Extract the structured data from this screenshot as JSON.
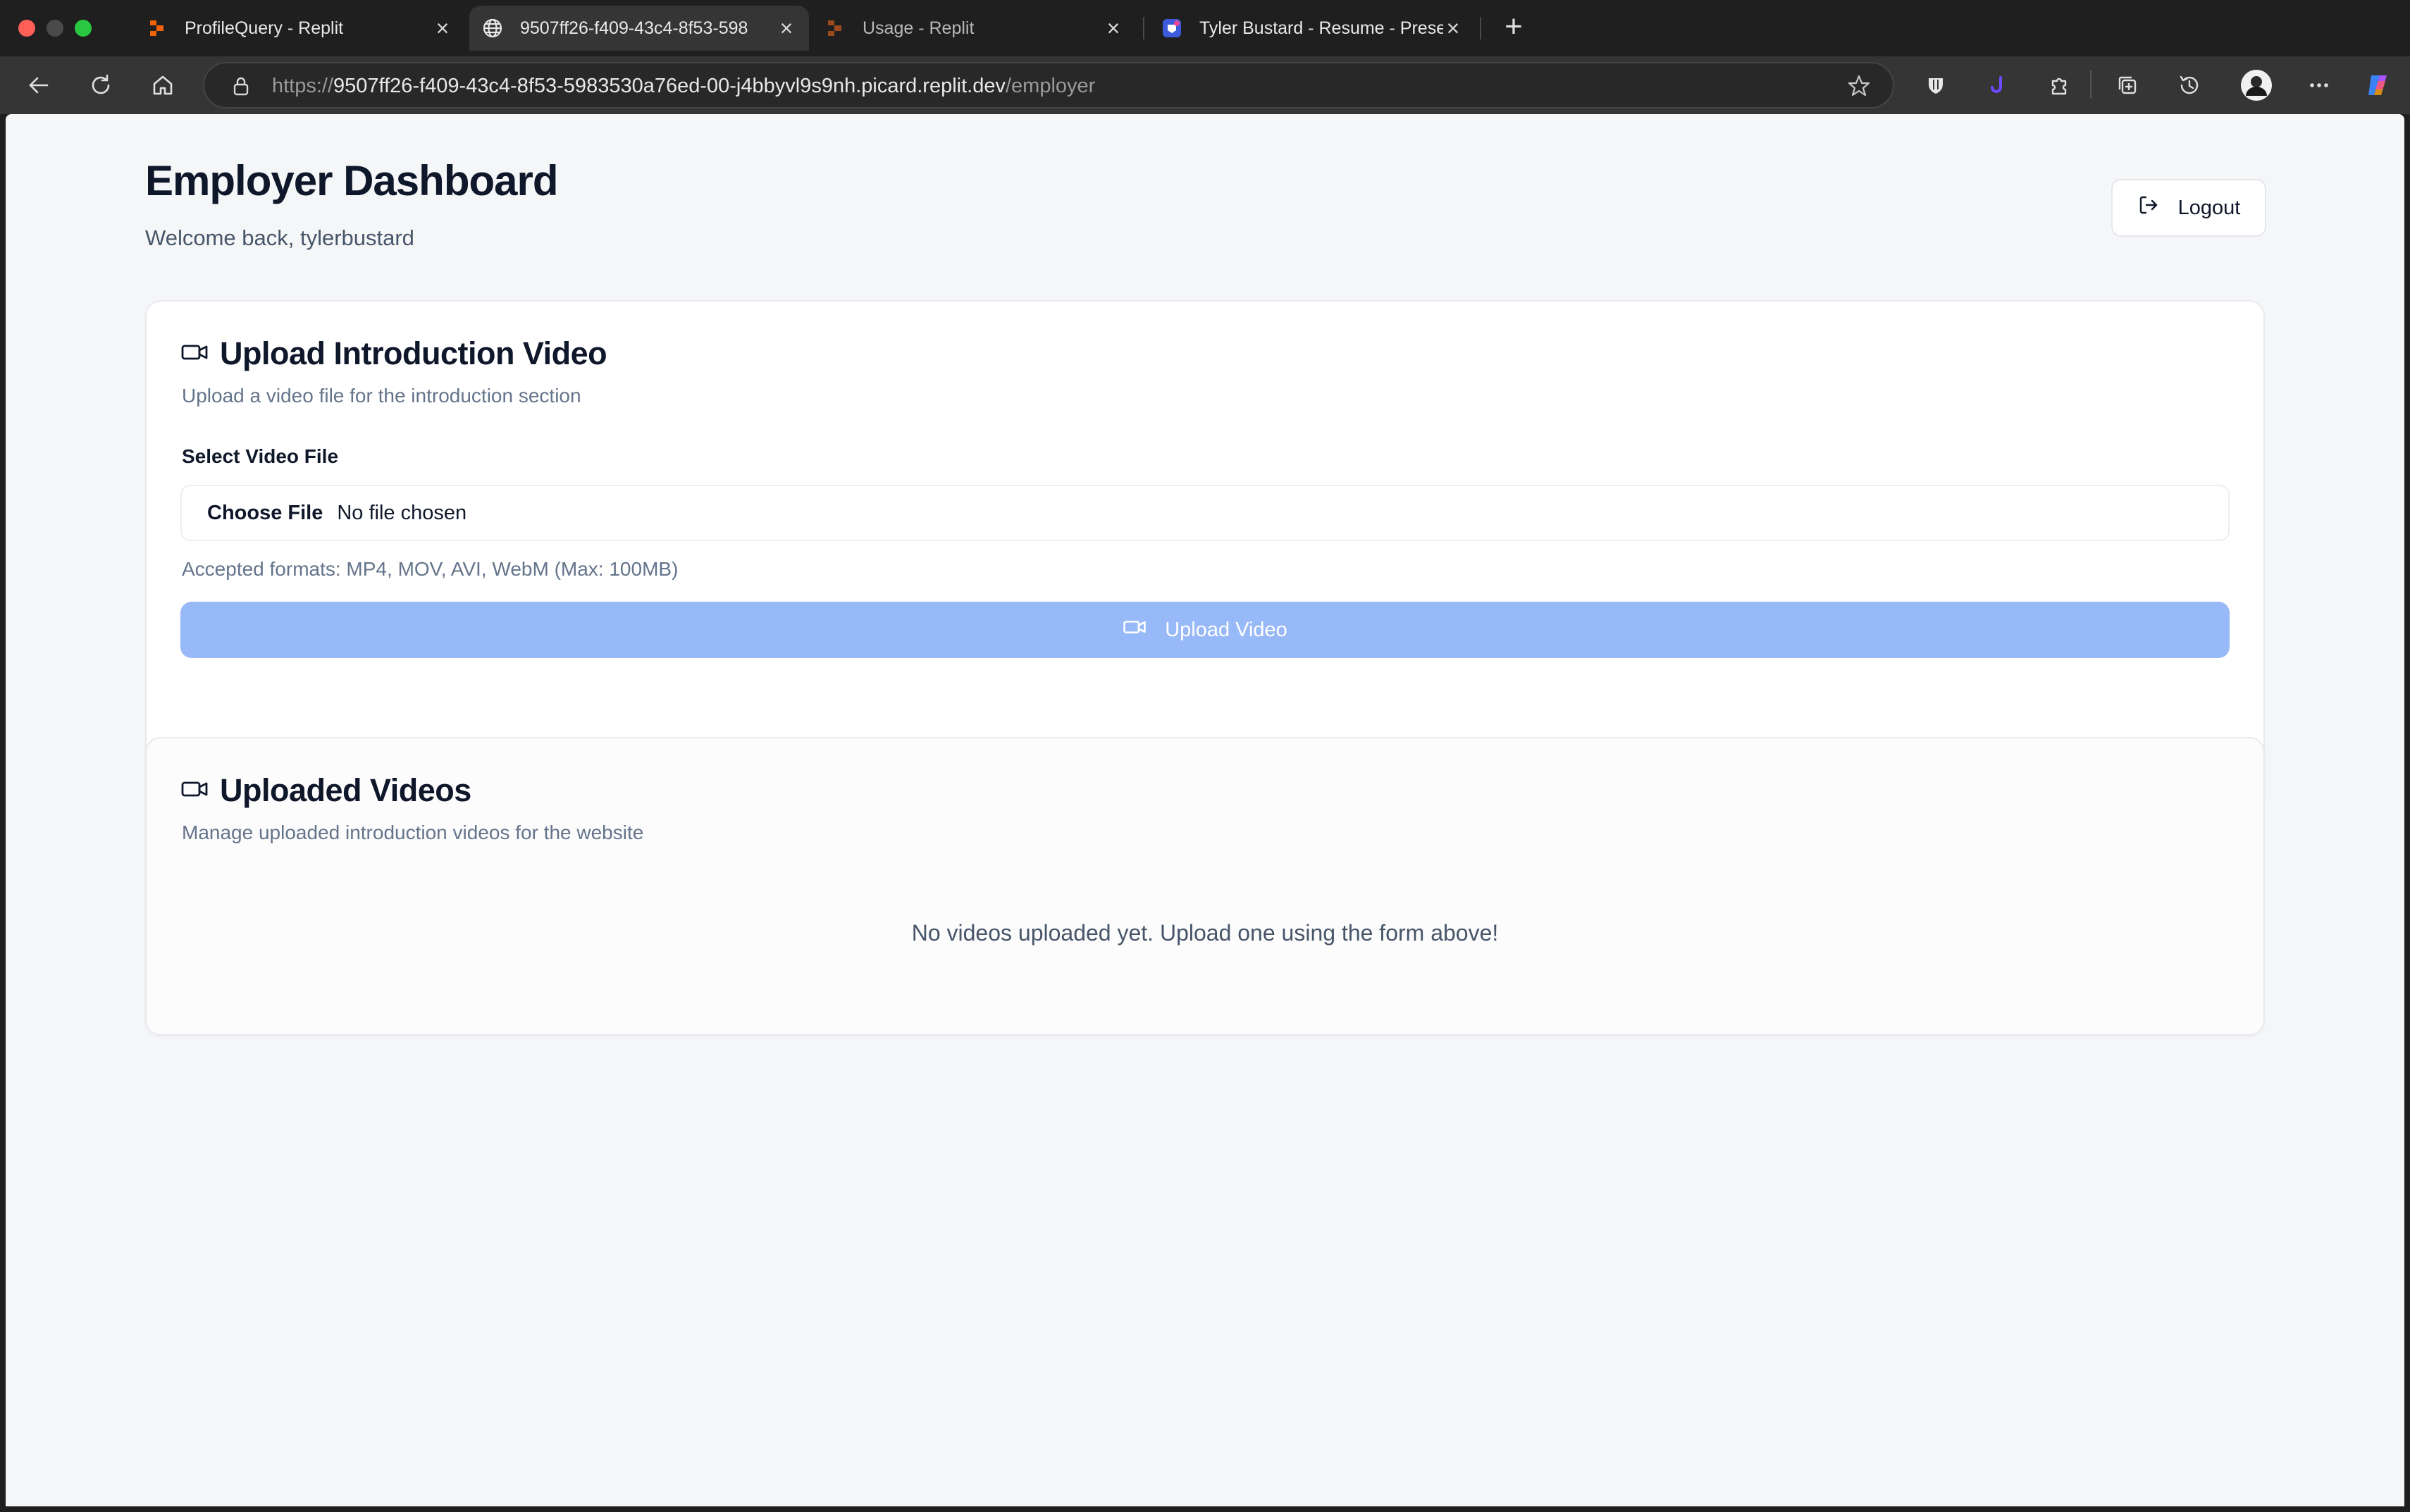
{
  "browser": {
    "tabs": [
      {
        "title": "ProfileQuery - Replit",
        "favicon": "replit-icon",
        "active": false
      },
      {
        "title": "9507ff26-f409-43c4-8f53-598",
        "favicon": "globe-icon",
        "active": true
      },
      {
        "title": "Usage - Replit",
        "favicon": "replit-icon",
        "active": false
      },
      {
        "title": "Tyler Bustard - Resume - Prese",
        "favicon": "app-icon",
        "active": false
      }
    ],
    "address": {
      "scheme": "https://",
      "host": "9507ff26-f409-43c4-8f53-5983530a76ed-00-j4bbyvl9s9nh.picard.replit.dev",
      "path": "/employer"
    }
  },
  "header": {
    "title": "Employer Dashboard",
    "welcome": "Welcome back, tylerbustard",
    "logout_label": "Logout"
  },
  "upload_card": {
    "title": "Upload Introduction Video",
    "subtitle": "Upload a video file for the introduction section",
    "field_label": "Select Video File",
    "choose_label": "Choose File",
    "file_status": "No file chosen",
    "hint": "Accepted formats: MP4, MOV, AVI, WebM (Max: 100MB)",
    "button_label": "Upload Video"
  },
  "videos_card": {
    "title": "Uploaded Videos",
    "subtitle": "Manage uploaded introduction videos for the website",
    "empty_message": "No videos uploaded yet. Upload one using the form above!"
  },
  "colors": {
    "page_bg": "#f5f6f8",
    "primary_disabled": "#98b9f8",
    "heading": "#0f172a",
    "muted": "#64748b"
  }
}
